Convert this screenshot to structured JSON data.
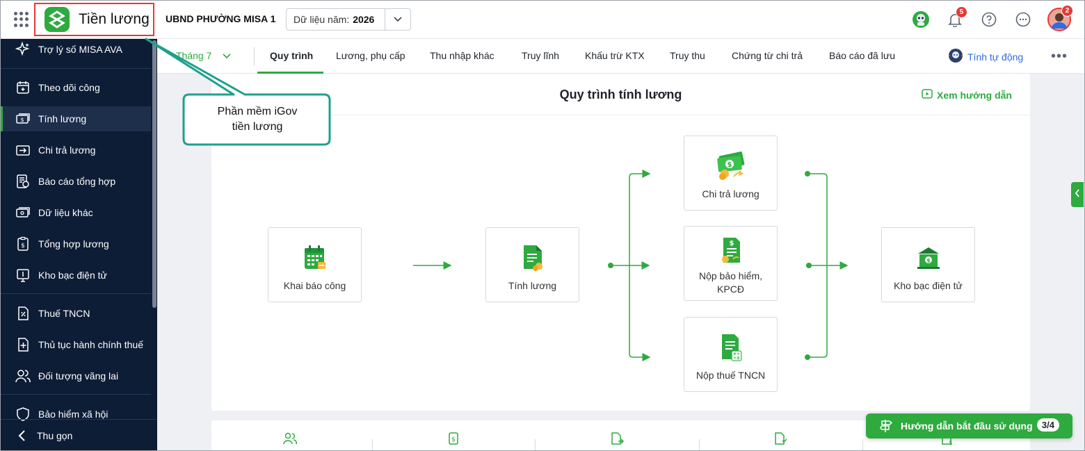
{
  "header": {
    "app_title": "Tiền lương",
    "org_name": "UBND PHƯỜNG MISA 1",
    "year_label": "Dữ liệu năm:",
    "year_value": "2026",
    "notification_count": "5",
    "avatar_badge": "2"
  },
  "sidebar": {
    "items": [
      {
        "label": "Trợ lý số MISA AVA",
        "icon": "sparkle-icon"
      },
      {
        "label": "Theo dõi công",
        "icon": "calendar-plus-icon"
      },
      {
        "label": "Tính lương",
        "icon": "money-icon"
      },
      {
        "label": "Chi trả lương",
        "icon": "transfer-icon"
      },
      {
        "label": "Báo cáo tổng hợp",
        "icon": "report-icon"
      },
      {
        "label": "Dữ liệu khác",
        "icon": "wallet-icon"
      },
      {
        "label": "Tổng hợp lương",
        "icon": "document-dollar-icon"
      },
      {
        "label": "Kho bạc điện tử",
        "icon": "treasury-icon"
      },
      {
        "label": "Thuế TNCN",
        "icon": "tax-icon"
      },
      {
        "label": "Thủ tục hành chính thuế",
        "icon": "document-plus-icon"
      },
      {
        "label": "Đối tượng vãng lai",
        "icon": "users-icon"
      },
      {
        "label": "Bảo hiểm xã hội",
        "icon": "shield-icon"
      }
    ],
    "collapse_label": "Thu gọn"
  },
  "tabs": {
    "month": "Tháng 7",
    "items": [
      "Quy trình",
      "Lương, phụ cấp",
      "Thu nhập khác",
      "Truy lĩnh",
      "Khấu trừ KTX",
      "Truy thu",
      "Chứng từ chi trả",
      "Báo cáo đã lưu"
    ],
    "auto_label": "Tính tự động"
  },
  "process": {
    "title": "Quy trình tính lương",
    "guide_label": "Xem hướng dẫn",
    "nodes": {
      "declare": "Khai báo công",
      "calc": "Tính lương",
      "pay": "Chi trả lương",
      "insurance_line1": "Nộp bảo hiểm,",
      "insurance_line2": "KPCĐ",
      "tax": "Nộp thuế TNCN",
      "treasury": "Kho bạc điện tử"
    }
  },
  "callout": {
    "line1": "Phần mềm iGov",
    "line2": "tiền lương"
  },
  "start_guide": {
    "label": "Hướng dẫn bắt đầu sử dụng",
    "step": "3/4"
  },
  "colors": {
    "brand_green": "#2eaa3f",
    "sidebar_bg": "#0e1d36",
    "highlight_red": "#e53935",
    "callout_teal": "#1ea08c",
    "link_blue": "#2e6be6"
  }
}
